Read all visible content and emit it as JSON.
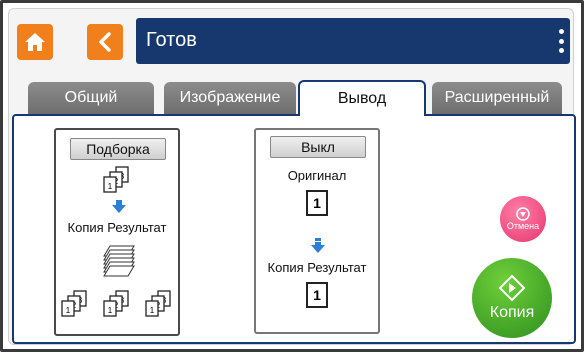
{
  "header": {
    "title": "Готов",
    "home_icon": "home-icon",
    "back_icon": "back-chevron-icon",
    "menu_icon": "vertical-dots-icon"
  },
  "tabs": [
    {
      "label": "Общий",
      "active": false
    },
    {
      "label": "Изображение",
      "active": false
    },
    {
      "label": "Вывод",
      "active": true
    },
    {
      "label": "Расширенный",
      "active": false
    }
  ],
  "options": {
    "collate": {
      "button_label": "Подборка",
      "result_label": "Копия Результат"
    },
    "off": {
      "button_label": "Выкл",
      "original_label": "Оригинал",
      "original_page": "1",
      "result_label": "Копия Результат",
      "result_page": "1"
    }
  },
  "actions": {
    "cancel_label": "Отмена",
    "copy_label": "Копия"
  },
  "colors": {
    "accent_orange": "#f07f1c",
    "title_navy": "#16386e",
    "cancel_pink": "#e6356d",
    "copy_green": "#2d8f1e",
    "arrow_blue": "#2a7fd6"
  }
}
